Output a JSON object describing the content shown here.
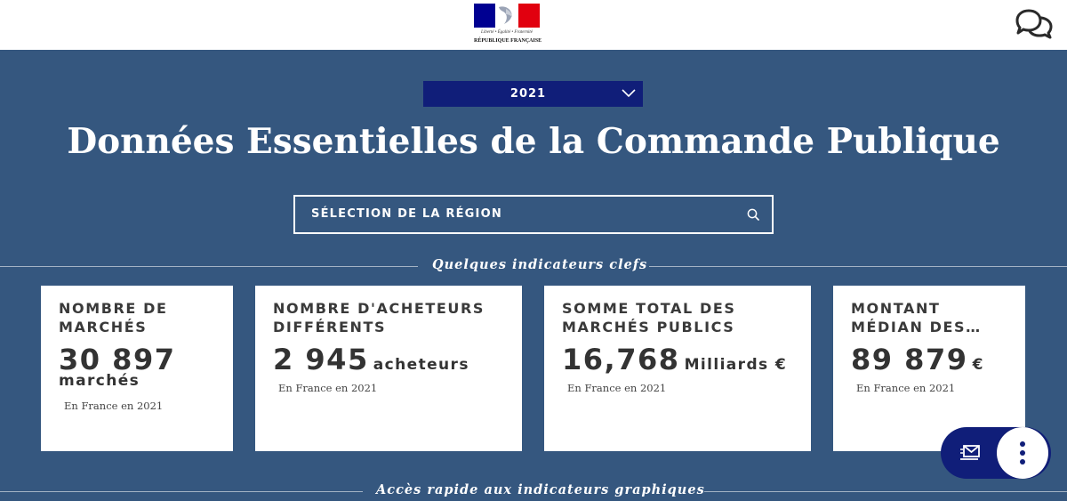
{
  "header": {
    "logo": {
      "motto": "Liberté • Égalité • Fraternité",
      "name": "RÉPUBLIQUE FRANÇAISE",
      "colors": [
        "#000091",
        "#ffffff",
        "#e1000f"
      ]
    },
    "chat_icon": "chat-bubbles-icon"
  },
  "year_select": {
    "selected": "2021",
    "icon": "chevron-down-icon"
  },
  "page_title": "Données Essentielles de la Commande Publique",
  "region_search": {
    "placeholder": "SÉLECTION DE LA RÉGION",
    "icon": "search-icon"
  },
  "indicators": {
    "section_title": "Quelques indicateurs clefs",
    "cards": [
      {
        "title": "NOMBRE DE MARCHÉS",
        "value": "30 897",
        "unit": "marchés",
        "note": "En France en 2021"
      },
      {
        "title": "NOMBRE D'ACHETEURS DIFFÉRENTS",
        "value": "2 945",
        "unit": "acheteurs",
        "note": "En France en 2021"
      },
      {
        "title": "SOMME TOTAL DES MARCHÉS PUBLICS",
        "value": "16,768",
        "unit": "Milliards €",
        "note": "En France en 2021"
      },
      {
        "title": "MONTANT MÉDIAN DES…",
        "value": "89 879",
        "unit": "€",
        "note": "En France en 2021"
      }
    ]
  },
  "quick_access": {
    "section_title": "Accès rapide aux indicateurs graphiques"
  },
  "fab": {
    "contact_icon": "mail-send-icon",
    "more_icon": "more-vertical-icon"
  },
  "colors": {
    "background": "#35577f",
    "accent": "#101e79",
    "card": "#ffffff"
  }
}
